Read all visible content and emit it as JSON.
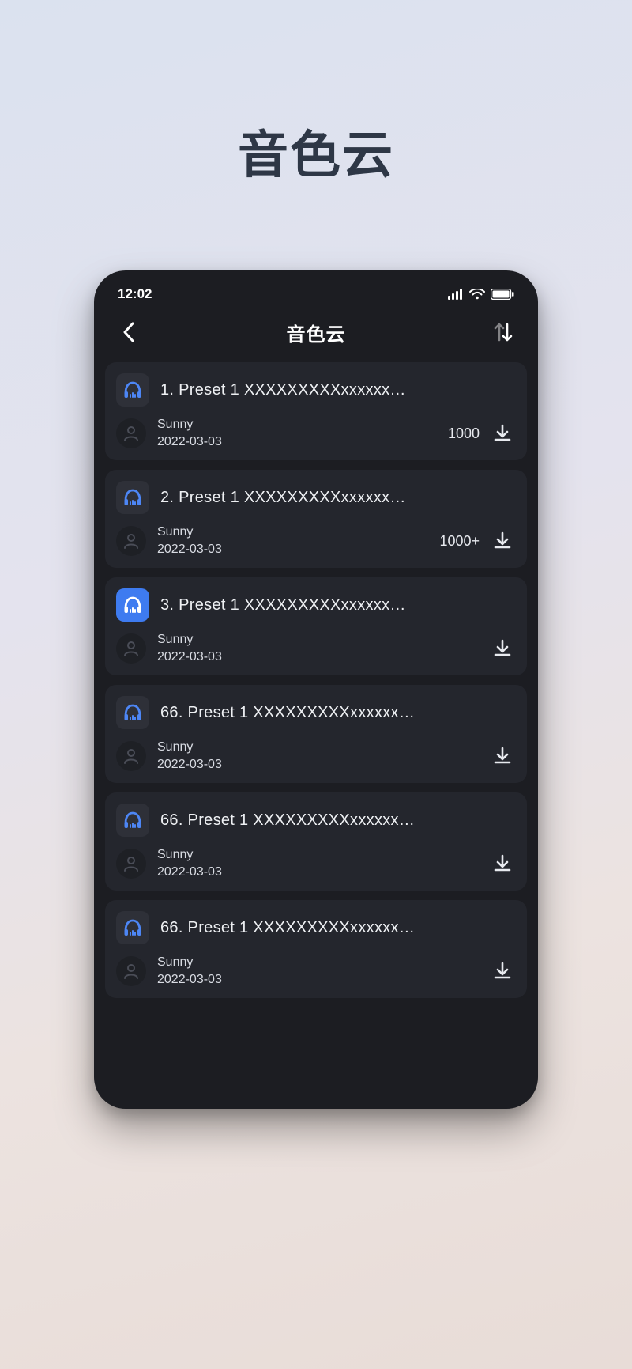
{
  "page_heading": "音色云",
  "status": {
    "time": "12:02"
  },
  "nav": {
    "title": "音色云"
  },
  "items": [
    {
      "index": "1",
      "name": "Preset 1 XXXXXXXXXxxxxxx…",
      "user": "Sunny",
      "date": "2022-03-03",
      "count": "1000",
      "selected": false
    },
    {
      "index": "2",
      "name": "Preset 1 XXXXXXXXXxxxxxx…",
      "user": "Sunny",
      "date": "2022-03-03",
      "count": "1000+",
      "selected": false
    },
    {
      "index": "3",
      "name": "Preset 1 XXXXXXXXXxxxxxx…",
      "user": "Sunny",
      "date": "2022-03-03",
      "count": "",
      "selected": true
    },
    {
      "index": "66",
      "name": "Preset 1 XXXXXXXXXxxxxxx…",
      "user": "Sunny",
      "date": "2022-03-03",
      "count": "",
      "selected": false
    },
    {
      "index": "66",
      "name": "Preset 1 XXXXXXXXXxxxxxx…",
      "user": "Sunny",
      "date": "2022-03-03",
      "count": "",
      "selected": false
    },
    {
      "index": "66",
      "name": "Preset 1 XXXXXXXXXxxxxxx…",
      "user": "Sunny",
      "date": "2022-03-03",
      "count": "",
      "selected": false
    }
  ]
}
